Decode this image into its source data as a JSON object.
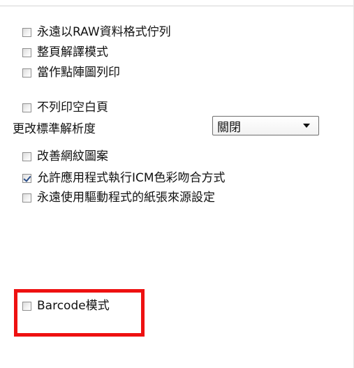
{
  "options": [
    {
      "label": "永遠以RAW資料格式佇列",
      "checked": false
    },
    {
      "label": "整頁解譯模式",
      "checked": false
    },
    {
      "label": "當作點陣圖列印",
      "checked": false
    },
    {
      "label": "不列印空白頁",
      "checked": false
    }
  ],
  "resolution": {
    "label": "更改標準解析度",
    "dropdown_value": "關閉"
  },
  "options2": [
    {
      "label": "改善網紋圖案",
      "checked": false
    },
    {
      "label": "允許應用程式執行ICM色彩吻合方式",
      "checked": true
    },
    {
      "label": "永遠使用驅動程式的紙張來源設定",
      "checked": false
    }
  ],
  "barcode": {
    "label": "Barcode模式",
    "checked": false
  },
  "highlight_color": "#ee1111",
  "icons": {
    "dropdown": "chevron-down-icon"
  }
}
